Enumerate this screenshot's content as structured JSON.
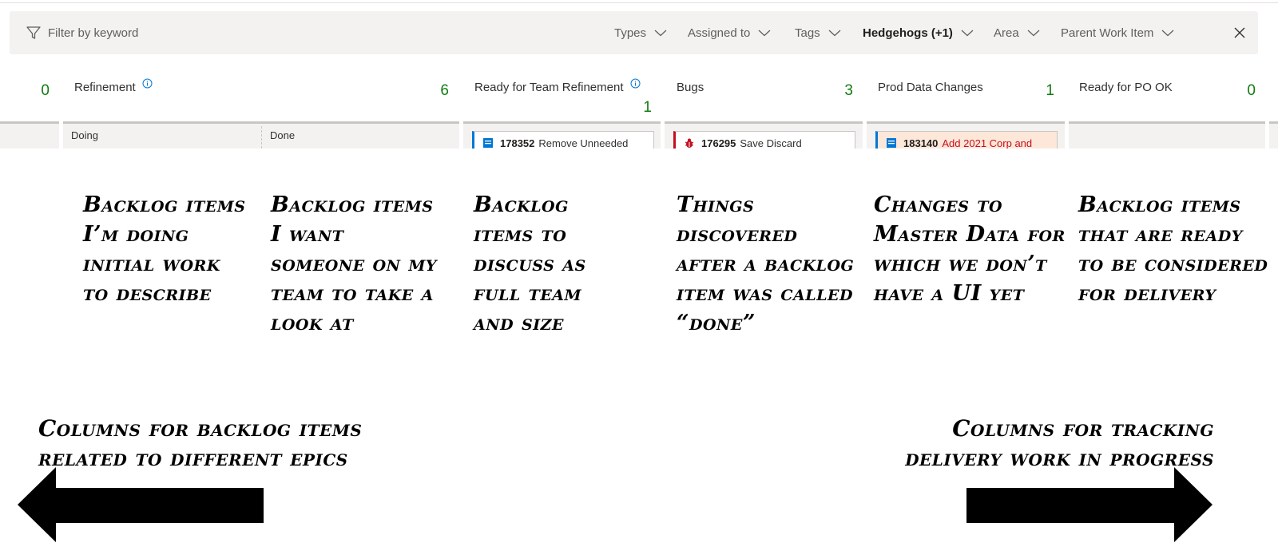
{
  "filter_bar": {
    "placeholder": "Filter by keyword",
    "pills": [
      {
        "label": "Types",
        "active": false
      },
      {
        "label": "Assigned to",
        "active": false
      },
      {
        "label": "Tags",
        "active": false
      },
      {
        "label": "Hedgehogs (+1)",
        "active": true
      },
      {
        "label": "Area",
        "active": false
      },
      {
        "label": "Parent Work Item",
        "active": false
      }
    ],
    "close_icon": "close-icon",
    "filter_icon": "filter-icon"
  },
  "board": {
    "leading_count": "0",
    "columns": [
      {
        "title": "Refinement",
        "count": "6",
        "has_info": true,
        "sub_columns": [
          "Doing",
          "Done"
        ]
      },
      {
        "title": "Ready for Team Refinement",
        "count": "1",
        "has_info": true
      },
      {
        "title": "Bugs",
        "count": "3",
        "has_info": false
      },
      {
        "title": "Prod Data Changes",
        "count": "1",
        "has_info": false
      },
      {
        "title": "Ready for PO OK",
        "count": "0",
        "has_info": false
      }
    ],
    "cards": [
      {
        "id": "178352",
        "title": "Remove Unneeded",
        "icon": "backlog-item-icon",
        "accent": "#0078d4"
      },
      {
        "id": "176295",
        "title": "Save Discard",
        "icon": "bug-icon",
        "accent": "#c50f1f"
      },
      {
        "id": "183140",
        "title": "Add 2021 Corp and",
        "icon": "backlog-item-icon",
        "accent": "#0078d4",
        "title_color": "#c50f1f",
        "background": "#fde7d9"
      }
    ]
  },
  "annotations": {
    "notes": [
      "Backlog items I’m doing initial work to describe",
      "Backlog items I want someone on my team to take a look at",
      "Backlog items to discuss as full team and size",
      "Things discovered after a backlog item was called “done”",
      "Changes to Master Data for which we don’t have a UI yet",
      "Backlog items that are ready to be considered for delivery"
    ],
    "left_caption": "Columns for backlog items related to different epics",
    "right_caption": "Columns for tracking delivery work in progress"
  }
}
